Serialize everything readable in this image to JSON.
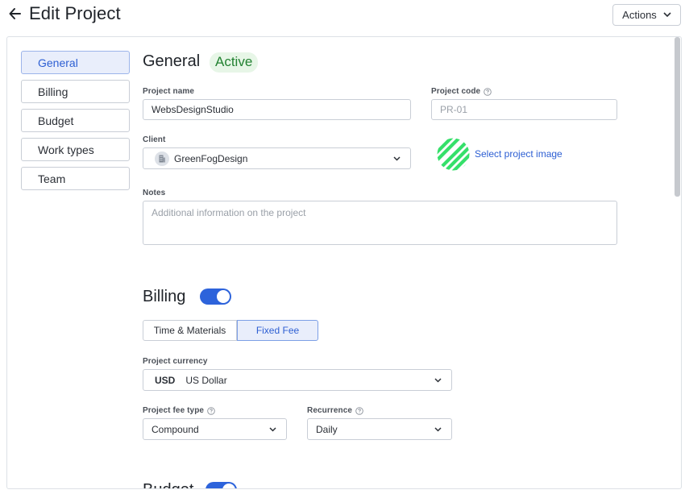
{
  "header": {
    "title": "Edit Project",
    "actions_label": "Actions"
  },
  "sidebar": {
    "items": [
      {
        "label": "General",
        "active": true
      },
      {
        "label": "Billing"
      },
      {
        "label": "Budget"
      },
      {
        "label": "Work types"
      },
      {
        "label": "Team"
      }
    ]
  },
  "general": {
    "title": "General",
    "status_badge": "Active",
    "project_name_label": "Project name",
    "project_name_value": "WebsDesignStudio",
    "project_code_label": "Project code",
    "project_code_placeholder": "PR-01",
    "client_label": "Client",
    "client_value": "GreenFogDesign",
    "select_image_link": "Select project image",
    "notes_label": "Notes",
    "notes_placeholder": "Additional information on the project"
  },
  "billing": {
    "title": "Billing",
    "enabled": true,
    "mode_options": [
      "Time & Materials",
      "Fixed Fee"
    ],
    "selected_mode": "Fixed Fee",
    "currency_label": "Project currency",
    "currency_code": "USD",
    "currency_name": "US Dollar",
    "fee_type_label": "Project fee type",
    "fee_type_value": "Compound",
    "recurrence_label": "Recurrence",
    "recurrence_value": "Daily"
  },
  "budget": {
    "title": "Budget",
    "enabled": true
  },
  "colors": {
    "accent": "#2d63db",
    "active_green": "#238232",
    "image_green": "#35e06a"
  }
}
